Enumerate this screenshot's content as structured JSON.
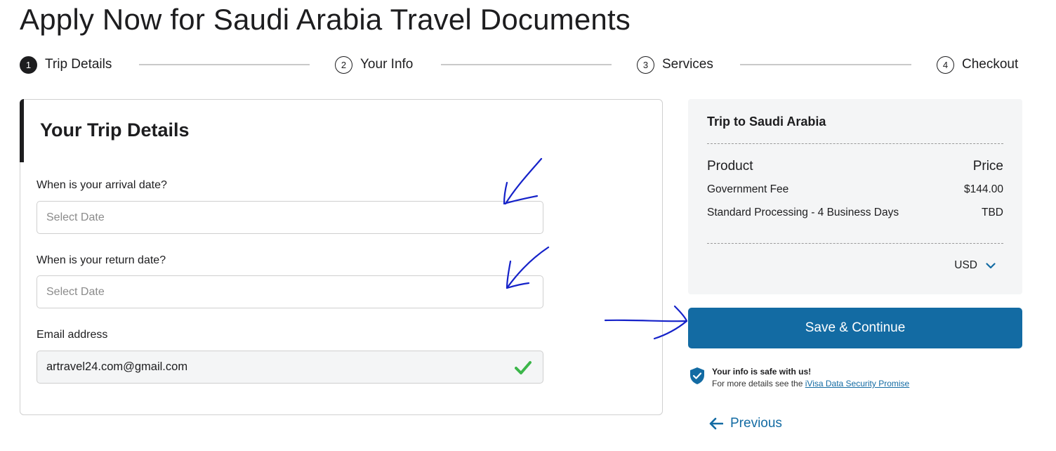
{
  "page": {
    "title": "Apply Now for Saudi Arabia Travel Documents"
  },
  "stepper": {
    "steps": [
      {
        "number": "1",
        "label": "Trip Details",
        "active": true
      },
      {
        "number": "2",
        "label": "Your Info",
        "active": false
      },
      {
        "number": "3",
        "label": "Services",
        "active": false
      },
      {
        "number": "4",
        "label": "Checkout",
        "active": false
      }
    ]
  },
  "form": {
    "title": "Your Trip Details",
    "arrival": {
      "label": "When is your arrival date?",
      "placeholder": "Select Date"
    },
    "return": {
      "label": "When is your return date?",
      "placeholder": "Select Date"
    },
    "email": {
      "label": "Email address",
      "value": "artravel24.com@gmail.com",
      "valid": true
    }
  },
  "summary": {
    "title": "Trip to Saudi Arabia",
    "header": {
      "product": "Product",
      "price": "Price"
    },
    "items": [
      {
        "product": "Government Fee",
        "price": "$144.00"
      },
      {
        "product": "Standard Processing - 4 Business Days",
        "price": "TBD"
      }
    ],
    "currency": "USD"
  },
  "actions": {
    "save_label": "Save & Continue",
    "previous_label": "Previous"
  },
  "security": {
    "title": "Your info is safe with us!",
    "text": "For more details see the ",
    "link": "iVisa Data Security Promise"
  },
  "colors": {
    "primary": "#136ba3",
    "dark": "#1d1d1f",
    "panel": "#f4f5f6",
    "success": "#3cb64a",
    "annotation": "#1522c9"
  }
}
